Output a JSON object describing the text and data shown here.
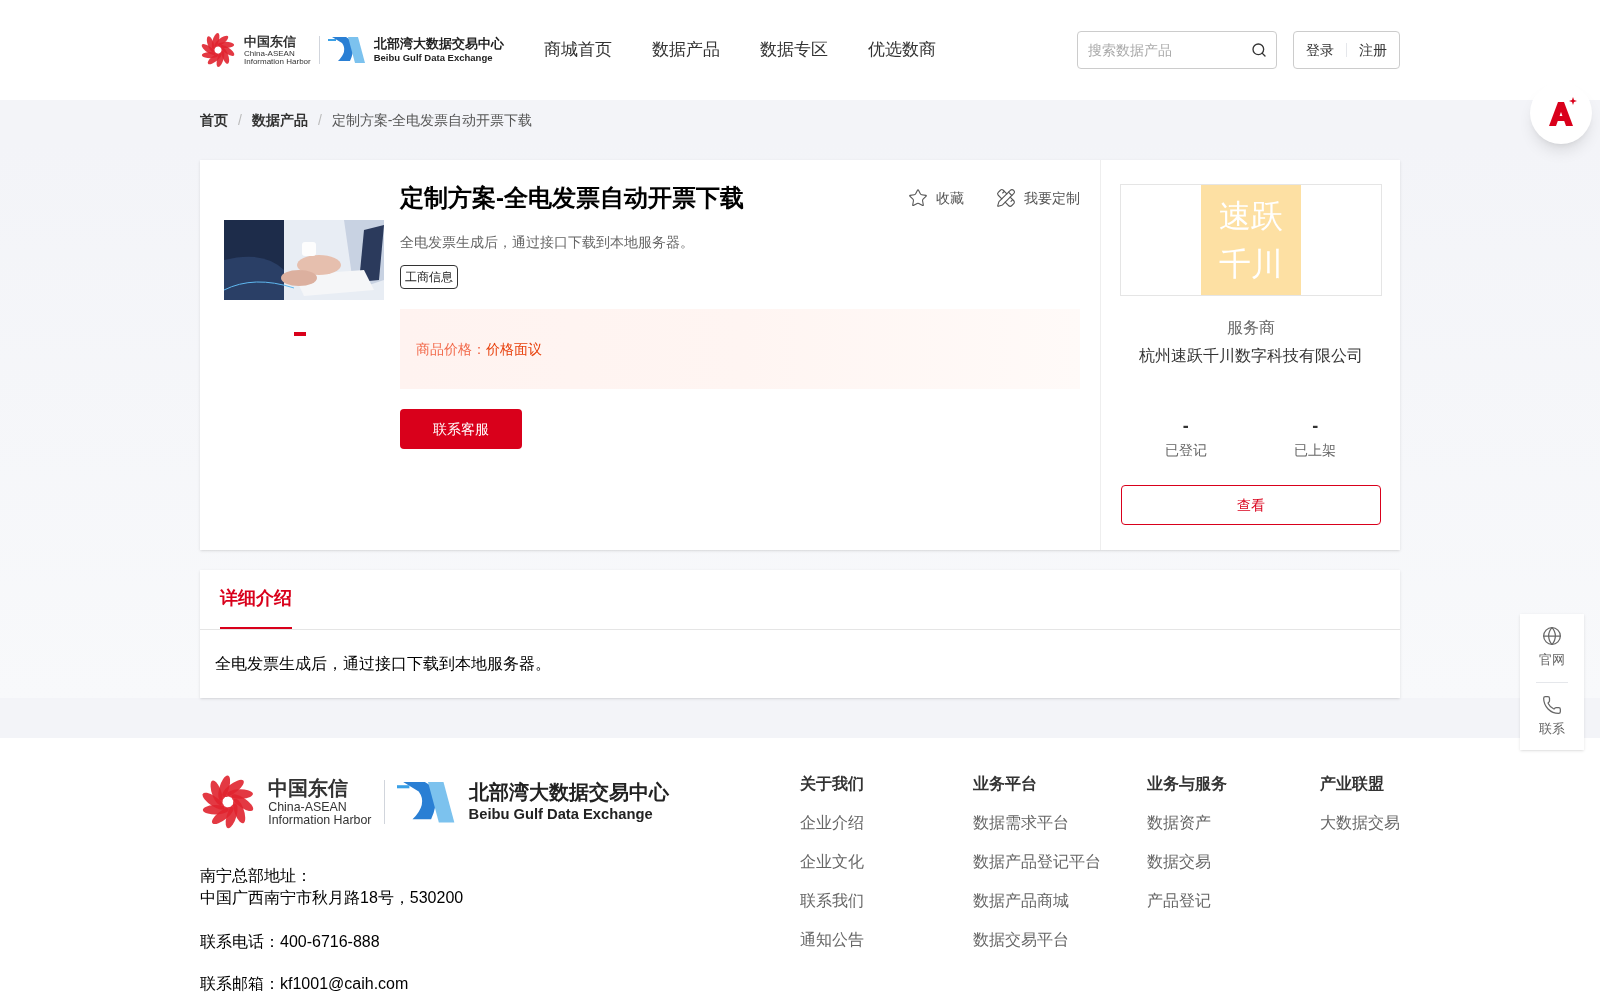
{
  "header": {
    "logo": {
      "cn_name": "中国东信",
      "en_name": "China-ASEAN",
      "en_sub": "Information Harbor",
      "exchange_cn": "北部湾大数据交易中心",
      "exchange_en": "Beibu Gulf Data Exchange"
    },
    "nav": [
      {
        "label": "商城首页"
      },
      {
        "label": "数据产品"
      },
      {
        "label": "数据专区"
      },
      {
        "label": "优选数商"
      }
    ],
    "search": {
      "placeholder": "搜索数据产品"
    },
    "auth": [
      "登录",
      "注册"
    ]
  },
  "breadcrumb": {
    "items": [
      "首页",
      "数据产品",
      "定制方案-全电发票自动开票下载"
    ],
    "separators": [
      "/",
      "/"
    ]
  },
  "product": {
    "title": "定制方案-全电发票自动开票下载",
    "actions": [
      "收藏",
      "我要定制"
    ],
    "description": "全电发票生成后，通过接口下载到本地服务器。",
    "tag": "工商信息",
    "price_label": "商品价格：",
    "price": "价格面议",
    "contact_button": "联系客服",
    "image": {
      "kind": "picture"
    }
  },
  "provider": {
    "logo_lines": [
      "速跃",
      "千川"
    ],
    "role": "服务商",
    "name": "杭州速跃千川数字科技有限公司",
    "stats": [
      {
        "value": "-",
        "label": "已登记"
      },
      {
        "value": "-",
        "label": "已上架"
      }
    ],
    "view_button": "查看"
  },
  "details": {
    "tabs": [
      {
        "label": "详细介绍",
        "selected": true
      }
    ],
    "text": "全电发票生成后，通过接口下载到本地服务器。"
  },
  "footer": {
    "logo": {
      "cn_name": "中国东信",
      "en_name": "China-ASEAN",
      "en_sub": "Information Harbor",
      "exchange_cn": "北部湾大数据交易中心",
      "exchange_en": "Beibu Gulf Data Exchange"
    },
    "address_label": "南宁总部地址：",
    "address": "中国广西南宁市秋月路18号，530200",
    "phone": "联系电话：400-6716-888",
    "email": "联系邮箱：kf1001@caih.com",
    "columns": [
      {
        "title": "关于我们",
        "links": [
          "企业介绍",
          "企业文化",
          "联系我们",
          "通知公告"
        ]
      },
      {
        "title": "业务平台",
        "links": [
          "数据需求平台",
          "数据产品登记平台",
          "数据产品商城",
          "数据交易平台"
        ]
      },
      {
        "title": "业务与服务",
        "links": [
          "数据资产",
          "数据交易",
          "产品登记"
        ]
      },
      {
        "title": "产业联盟",
        "links": [
          "大数据交易"
        ]
      }
    ]
  },
  "side_panel": [
    {
      "kind": "globe",
      "label": "官网"
    },
    {
      "kind": "phone",
      "label": "联系"
    }
  ]
}
